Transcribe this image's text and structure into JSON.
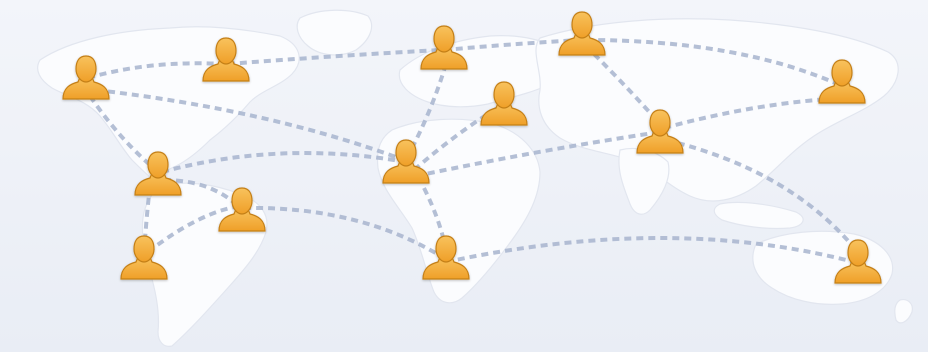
{
  "scene": {
    "background_color": "#eef1f7",
    "land_color": "#fbfcfe",
    "land_edge_color": "#e2e6ef",
    "connection_color": "#a8b5cf",
    "person_icon": "person-silhouette-icon",
    "person_fill": "#f5ad3c",
    "person_stroke": "#c47f17"
  }
}
